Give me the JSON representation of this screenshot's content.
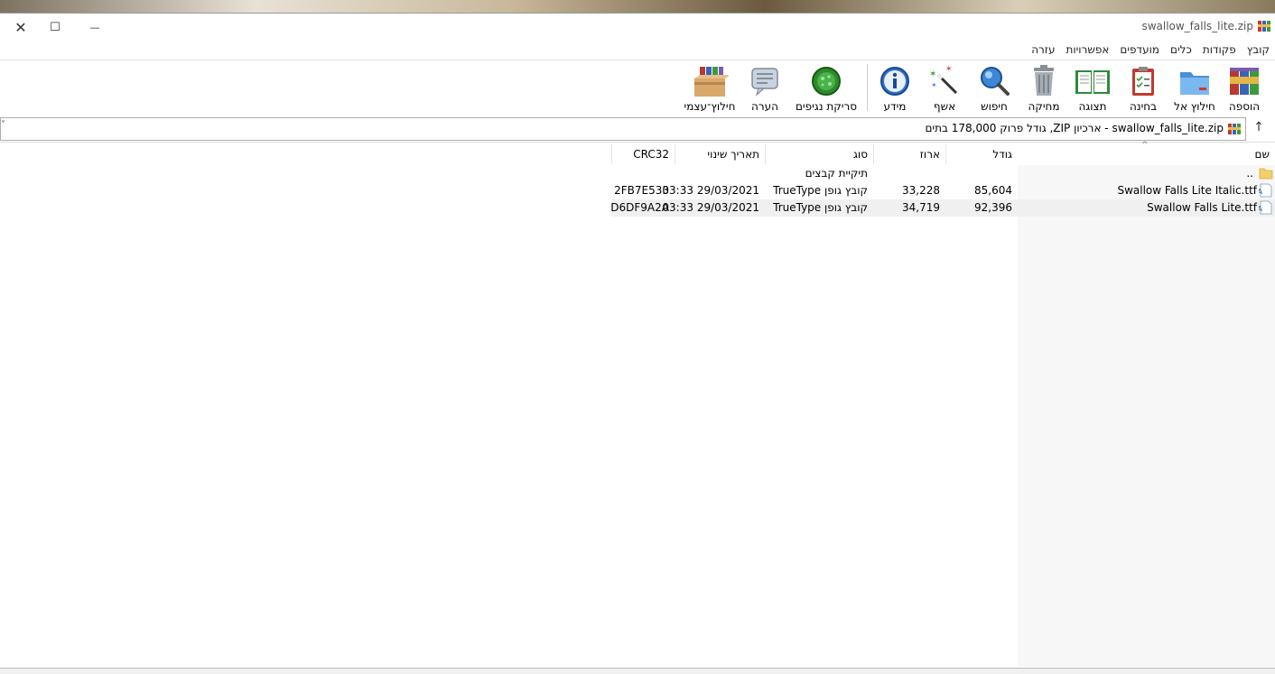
{
  "window": {
    "title": "swallow_falls_lite.zip",
    "close_glyph": "✕",
    "maximize_glyph": "☐",
    "minimize_glyph": "—"
  },
  "menu": [
    "קובץ",
    "פקודות",
    "כלים",
    "מועדפים",
    "אפשרויות",
    "עזרה"
  ],
  "toolbar": {
    "add": "הוספה",
    "extract_to": "חילוץ אל",
    "test": "בחינה",
    "view": "תצוגה",
    "delete": "מחיקה",
    "find": "חיפוש",
    "wizard": "אשף",
    "info": "מידע",
    "virus_scan": "סריקת נגיפים",
    "comment": "הערה",
    "sfx": "חילוץ־עצמי"
  },
  "address": {
    "text": "swallow_falls_lite.zip - ארכיון ZIP, גודל פרוק 178,000 בתים",
    "up_glyph": "↑",
    "dropdown_glyph": "˅"
  },
  "columns": {
    "name": "שם",
    "size": "גודל",
    "packed": "ארוז",
    "type": "סוג",
    "modified": "תאריך שינוי",
    "crc": "CRC32",
    "sort_glyph": "^"
  },
  "rows": [
    {
      "name": "..",
      "size": "",
      "packed": "",
      "type": "תיקיית קבצים",
      "modified": "",
      "crc": ""
    },
    {
      "name": "Swallow Falls Lite Italic.ttf",
      "size": "85,604",
      "packed": "33,228",
      "type": "קובץ גופן TrueType",
      "modified": "29/03/2021 03:33",
      "crc": "2FB7E533"
    },
    {
      "name": "Swallow Falls Lite.ttf",
      "size": "92,396",
      "packed": "34,719",
      "type": "קובץ גופן TrueType",
      "modified": "29/03/2021 03:33",
      "crc": "D6DF9A2A"
    }
  ],
  "colors": {
    "selected_row": "#f0f0f0",
    "name_column_bg": "#f7f7f7"
  }
}
